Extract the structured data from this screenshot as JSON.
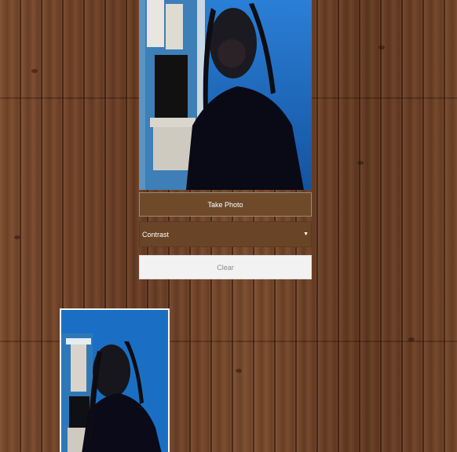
{
  "controls": {
    "take_photo_label": "Take Photo",
    "filter_selected": "Contrast",
    "clear_label": "Clear"
  },
  "icons": {
    "dropdown_arrow": "chevron-down-icon"
  },
  "colors": {
    "button_brown": "#6e4a2a",
    "clear_background": "#f2f2f2",
    "camera_blue": "#1f6fc2"
  }
}
